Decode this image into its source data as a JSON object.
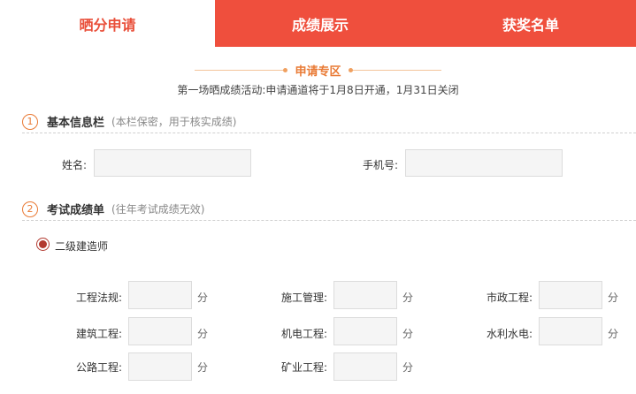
{
  "tabs": [
    {
      "label": "晒分申请"
    },
    {
      "label": "成绩展示"
    },
    {
      "label": "获奖名单"
    }
  ],
  "zone": {
    "title": "申请专区",
    "notice": "第一场晒成绩活动:申请通道将于1月8日开通，1月31日关闭"
  },
  "basic": {
    "num": "1",
    "title": "基本信息栏",
    "note": "(本栏保密，用于核实成绩)",
    "name_label": "姓名:",
    "phone_label": "手机号:"
  },
  "exam": {
    "num": "2",
    "title": "考试成绩单",
    "note": "(往年考试成绩无效)",
    "radio_label": "二级建造师",
    "unit": "分",
    "subjects": [
      {
        "label": "工程法规:"
      },
      {
        "label": "施工管理:"
      },
      {
        "label": "市政工程:"
      },
      {
        "label": "建筑工程:"
      },
      {
        "label": "机电工程:"
      },
      {
        "label": "水利水电:"
      },
      {
        "label": "公路工程:"
      },
      {
        "label": "矿业工程:"
      }
    ]
  }
}
